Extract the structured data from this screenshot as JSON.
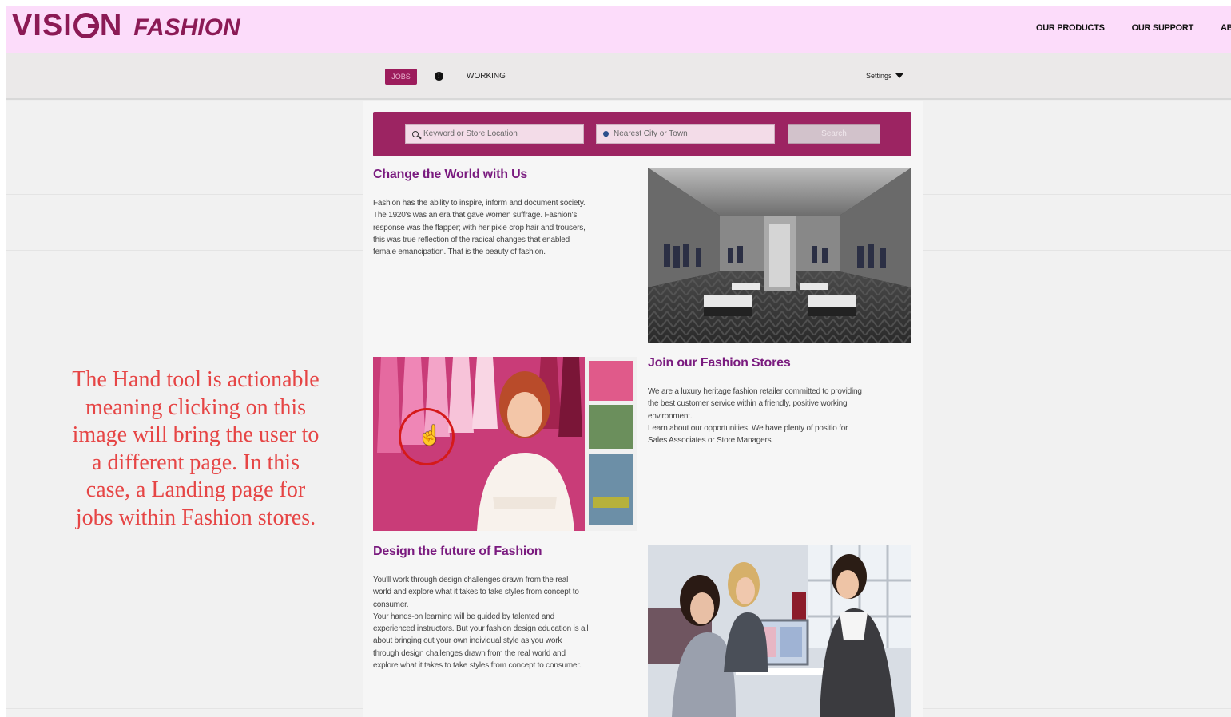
{
  "header": {
    "logo_main": "VISION",
    "logo_sub": "FASHION",
    "nav": [
      "OUR PRODUCTS",
      "OUR SUPPORT",
      "AB"
    ]
  },
  "subnav": {
    "jobs": "JOBS",
    "working": "WORKING",
    "settings": "Settings"
  },
  "search": {
    "keyword_placeholder": "Keyword or Store Location",
    "location_placeholder": "Nearest City or Town",
    "button": "Search"
  },
  "sections": {
    "change": {
      "title": "Change the World with Us",
      "lines": [
        "Fashion has the ability to inspire, inform and document society.",
        "The 1920's was an era that gave women suffrage. Fashion's",
        "response was the flapper; with her pixie crop hair and trousers,",
        "this was true reflection of the radical changes that enabled",
        "female emancipation. That is the beauty of fashion."
      ]
    },
    "join": {
      "title": "Join our Fashion Stores",
      "lines": [
        "We are a luxury heritage fashion retailer committed to providing",
        "the best customer service within a friendly, positive working",
        "environment.",
        "Learn about our opportunities. We have plenty of positio for",
        "Sales Associates or Store Managers."
      ]
    },
    "design": {
      "title": "Design the future of Fashion",
      "lines": [
        "You'll work through design challenges drawn from the real",
        "world and explore what it takes to take styles from concept to",
        "consumer.",
        "Your hands-on learning will be guided by talented and",
        "experienced instructors. But your fashion design education is all",
        "about bringing out your own individual style as you work",
        "through design challenges drawn from the real world and",
        "explore what it takes to take styles from concept to consumer."
      ]
    }
  },
  "annotation": {
    "lines": [
      "The Hand tool is actionable",
      "meaning clicking on this",
      "image will bring the user to",
      "a different page. In this",
      "case, a Landing page for",
      "jobs within Fashion stores."
    ]
  },
  "icons": {
    "search": "magnifier-icon",
    "location": "location-pin-icon",
    "info": "info-icon",
    "dropdown": "caret-down-icon",
    "cursor": "hand-pointer-icon"
  },
  "colors": {
    "brand": "#8b1a55",
    "header_bg": "#fcdcfa",
    "search_bg": "#9c2462",
    "heading": "#7a1b7f",
    "annotation": "#e64545"
  }
}
